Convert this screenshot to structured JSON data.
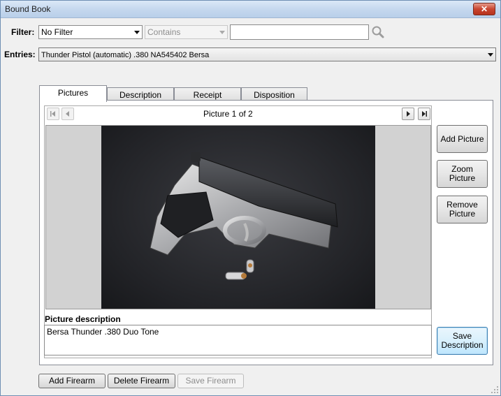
{
  "window": {
    "title": "Bound Book"
  },
  "filter": {
    "label": "Filter:",
    "field_value": "No Filter",
    "operator_value": "Contains",
    "search_value": ""
  },
  "entries": {
    "label": "Entries:",
    "selected": "Thunder Pistol (automatic) .380 NA545402 Bersa"
  },
  "tabs": [
    {
      "label": "Pictures"
    },
    {
      "label": "Description"
    },
    {
      "label": "Receipt"
    },
    {
      "label": "Disposition"
    }
  ],
  "pictures": {
    "counter": "Picture 1 of 2",
    "description_label": "Picture description",
    "description_value": "Bersa Thunder .380 Duo Tone"
  },
  "side_buttons": {
    "add_picture": "Add Picture",
    "zoom_picture_1": "Zoom",
    "zoom_picture_2": "Picture",
    "remove_picture_1": "Remove",
    "remove_picture_2": "Picture",
    "save_description_1": "Save",
    "save_description_2": "Description"
  },
  "bottom_buttons": {
    "add_firearm": "Add Firearm",
    "delete_firearm": "Delete Firearm",
    "save_firearm": "Save Firearm"
  }
}
